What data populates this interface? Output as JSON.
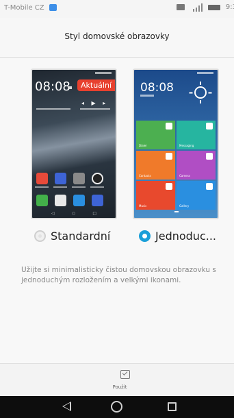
{
  "status_bar": {
    "carrier": "T-Mobile CZ",
    "time": "9:3"
  },
  "header": {
    "title": "Styl domovské obrazovky"
  },
  "styles": {
    "standard": {
      "label": "Standardní",
      "selected": false,
      "preview_clock": "08:08",
      "current_badge": "Aktuální"
    },
    "simple": {
      "label": "Jednoduc...",
      "selected": true,
      "preview_clock": "08:08",
      "tiles": [
        {
          "label": "Dialer",
          "color": "#4caf50"
        },
        {
          "label": "Messaging",
          "color": "#26b5a0"
        },
        {
          "label": "Contacts",
          "color": "#f07a2a"
        },
        {
          "label": "Camera",
          "color": "#b04ec4"
        },
        {
          "label": "Music",
          "color": "#e8492d"
        },
        {
          "label": "Gallery",
          "color": "#2a8fe0"
        }
      ]
    }
  },
  "description": "Užijte si minimalisticky čistou domovskou obrazovku s jednoduchým rozložením a velkými ikonami.",
  "bottom_bar": {
    "apply_label": "Použít"
  },
  "colors": {
    "accent": "#1a9fd8",
    "badge": "#e8412f"
  }
}
